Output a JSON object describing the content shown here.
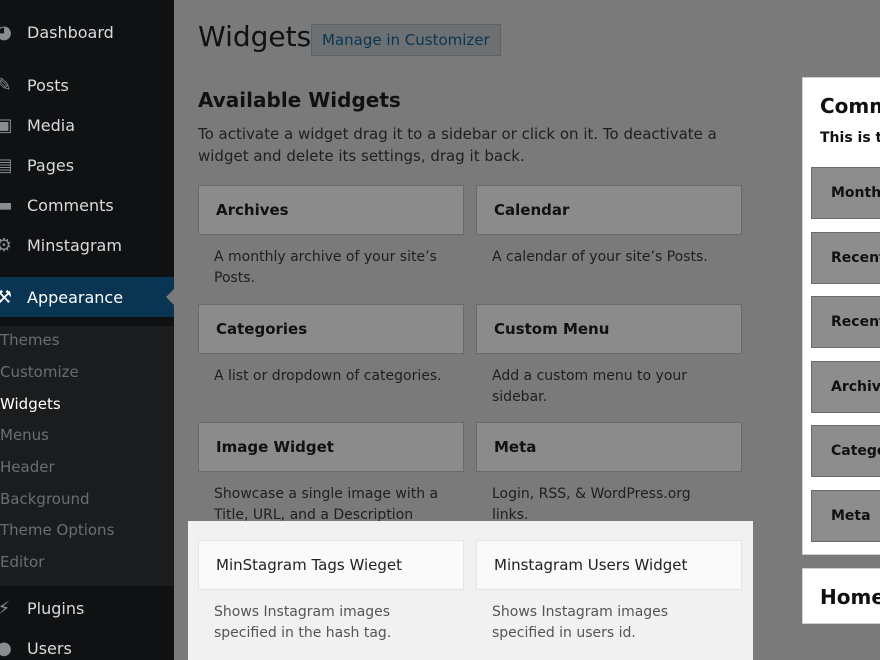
{
  "sidebar": {
    "items": [
      {
        "label": "Dashboard",
        "icon": "dashboard-icon"
      },
      {
        "label": "Posts",
        "icon": "pin-icon"
      },
      {
        "label": "Media",
        "icon": "media-icon"
      },
      {
        "label": "Pages",
        "icon": "pages-icon"
      },
      {
        "label": "Comments",
        "icon": "comments-icon"
      },
      {
        "label": "Minstagram",
        "icon": "gear-icon"
      },
      {
        "label": "Appearance",
        "icon": "brush-icon"
      },
      {
        "label": "Plugins",
        "icon": "plugin-icon"
      },
      {
        "label": "Users",
        "icon": "user-icon"
      }
    ],
    "submenu": [
      "Themes",
      "Customize",
      "Widgets",
      "Menus",
      "Header",
      "Background",
      "Theme Options",
      "Editor"
    ]
  },
  "main": {
    "title": "Widgets",
    "customizer_button": "Manage in Customizer",
    "section_title": "Available Widgets",
    "description": "To activate a widget drag it to a sidebar or click on it. To deactivate a widget and delete its settings, drag it back.",
    "widgets": [
      {
        "title": "Archives",
        "desc": "A monthly archive of your site’s Posts."
      },
      {
        "title": "Calendar",
        "desc": "A calendar of your site’s Posts."
      },
      {
        "title": "Categories",
        "desc": "A list or dropdown of categories."
      },
      {
        "title": "Custom Menu",
        "desc": "Add a custom menu to your sidebar."
      },
      {
        "title": "Image Widget",
        "desc": "Showcase a single image with a Title, URL, and a Description"
      },
      {
        "title": "Meta",
        "desc": "Login, RSS, & WordPress.org links."
      },
      {
        "title": "MinStagram Tags Wieget",
        "desc": "Shows Instagram images specified in the hash tag."
      },
      {
        "title": "Minstagram Users Widget",
        "desc": "Shows Instagram images specified in users id."
      }
    ]
  },
  "right_sidebar": {
    "title": "Comm",
    "subtitle": "This is th",
    "widgets": [
      "Month",
      "Recent",
      "Recent",
      "Archive",
      "Catego",
      "Meta"
    ],
    "home_title": "Home"
  },
  "colors": {
    "sidebar_bg": "#0f1113",
    "active_bg": "#0a3552",
    "overlay": "#7a7a7a"
  }
}
